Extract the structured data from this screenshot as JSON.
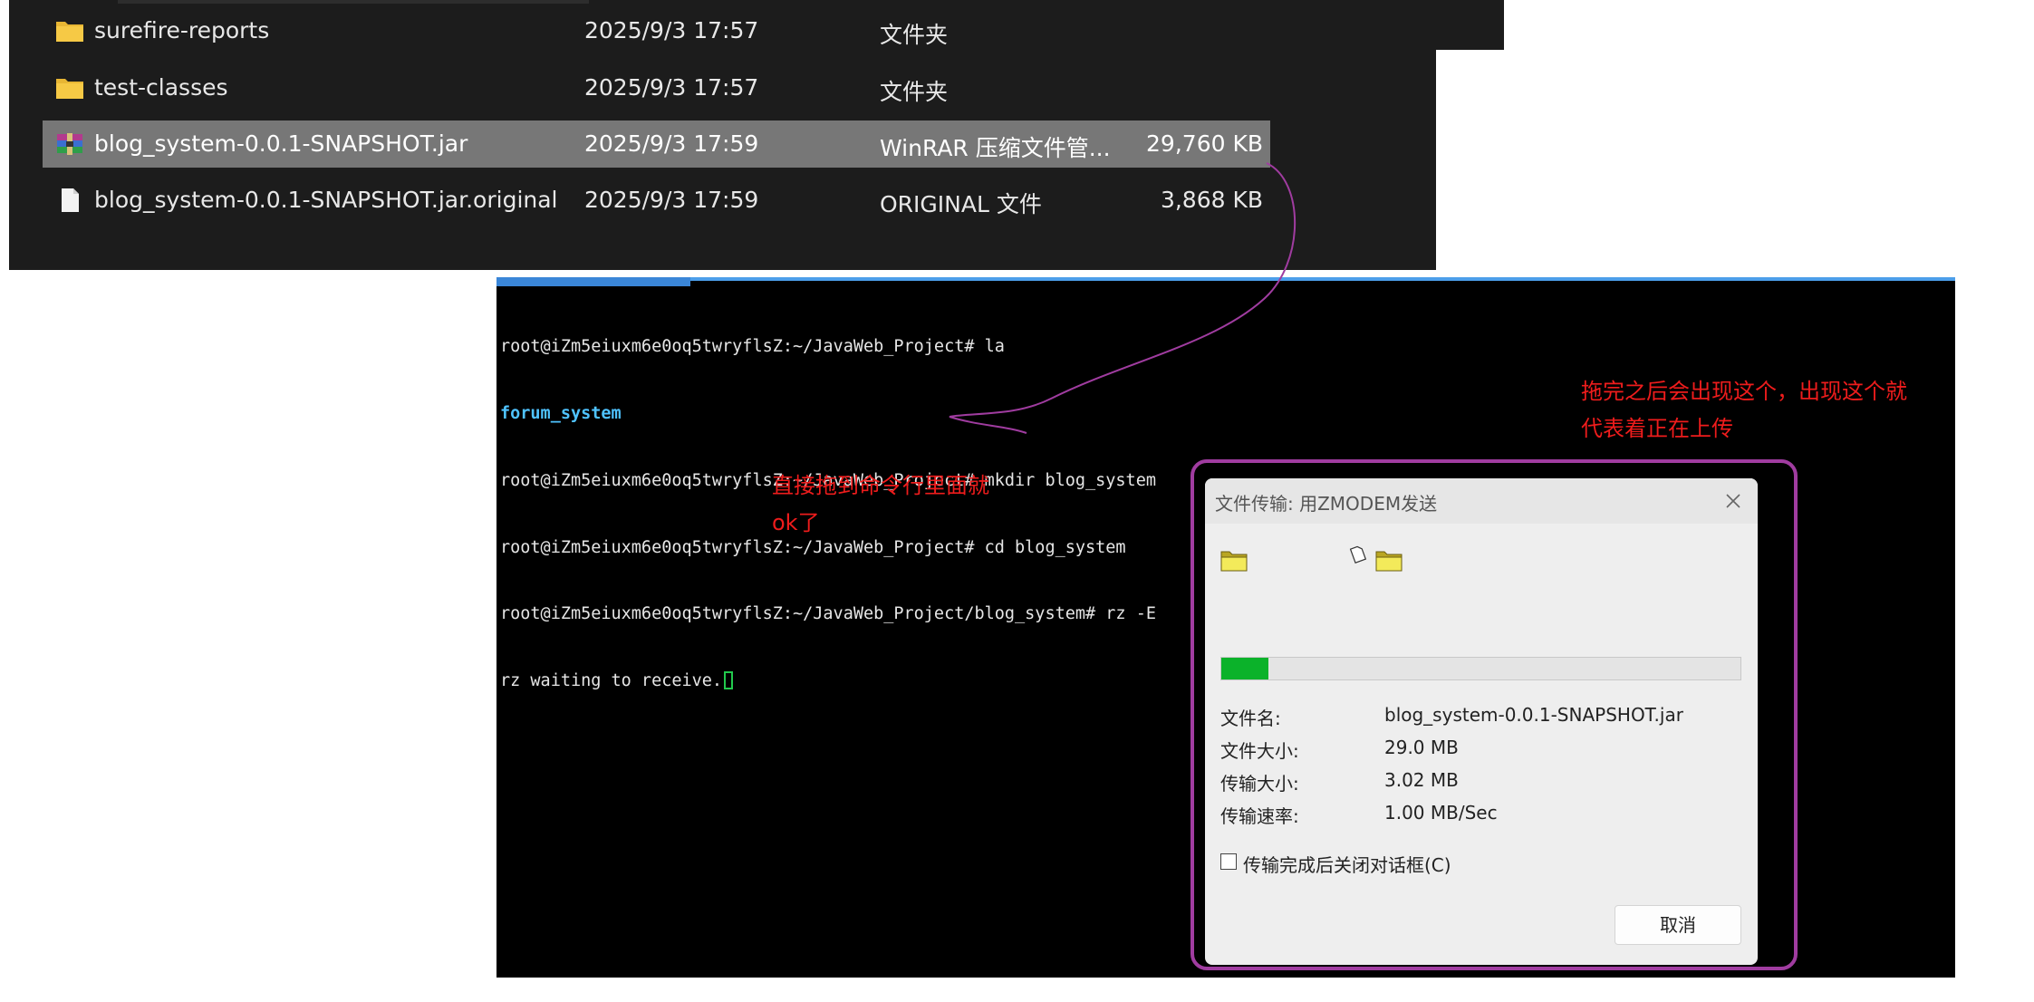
{
  "explorer": {
    "files": [
      {
        "name": "surefire-reports",
        "date": "2025/9/3 17:57",
        "type": "文件夹",
        "size": "",
        "icon": "folder-icon",
        "selected": false
      },
      {
        "name": "test-classes",
        "date": "2025/9/3 17:57",
        "type": "文件夹",
        "size": "",
        "icon": "folder-icon",
        "selected": false
      },
      {
        "name": "blog_system-0.0.1-SNAPSHOT.jar",
        "date": "2025/9/3 17:59",
        "type": "WinRAR 压缩文件管...",
        "size": "29,760 KB",
        "icon": "winrar-archive-icon",
        "selected": true
      },
      {
        "name": "blog_system-0.0.1-SNAPSHOT.jar.original",
        "date": "2025/9/3 17:59",
        "type": "ORIGINAL 文件",
        "size": "3,868 KB",
        "icon": "file-icon",
        "selected": false
      }
    ]
  },
  "terminal": {
    "lines": [
      "root@iZm5eiuxm6e0oq5twryflsZ:~/JavaWeb_Project# la",
      "forum_system",
      "root@iZm5eiuxm6e0oq5twryflsZ:~/JavaWeb_Project# mkdir blog_system",
      "root@iZm5eiuxm6e0oq5twryflsZ:~/JavaWeb_Project# cd blog_system",
      "root@iZm5eiuxm6e0oq5twryflsZ:~/JavaWeb_Project/blog_system# rz -E",
      "rz waiting to receive."
    ]
  },
  "notes": {
    "left": [
      "直接拖到命令行里面就",
      "ok了"
    ],
    "right": [
      "拖完之后会出现这个，出现这个就",
      "代表着正在上传"
    ]
  },
  "dialog": {
    "title": "文件传输: 用ZMODEM发送",
    "progress": 0.09,
    "info": [
      {
        "label": "文件名:",
        "value": "blog_system-0.0.1-SNAPSHOT.jar"
      },
      {
        "label": "文件大小:",
        "value": "29.0 MB"
      },
      {
        "label": "传输大小:",
        "value": "3.02 MB"
      },
      {
        "label": "传输速率:",
        "value": "1.00 MB/Sec"
      }
    ],
    "close_on_complete_label": "传输完成后关闭对话框(C)",
    "close_on_complete_checked": false,
    "cancel_label": "取消"
  },
  "colors": {
    "note_red": "#ee1c1c",
    "frame_purple": "#a03ca0",
    "progress_green": "#0bb22a",
    "terminal_dir_blue": "#4fc3ff"
  }
}
